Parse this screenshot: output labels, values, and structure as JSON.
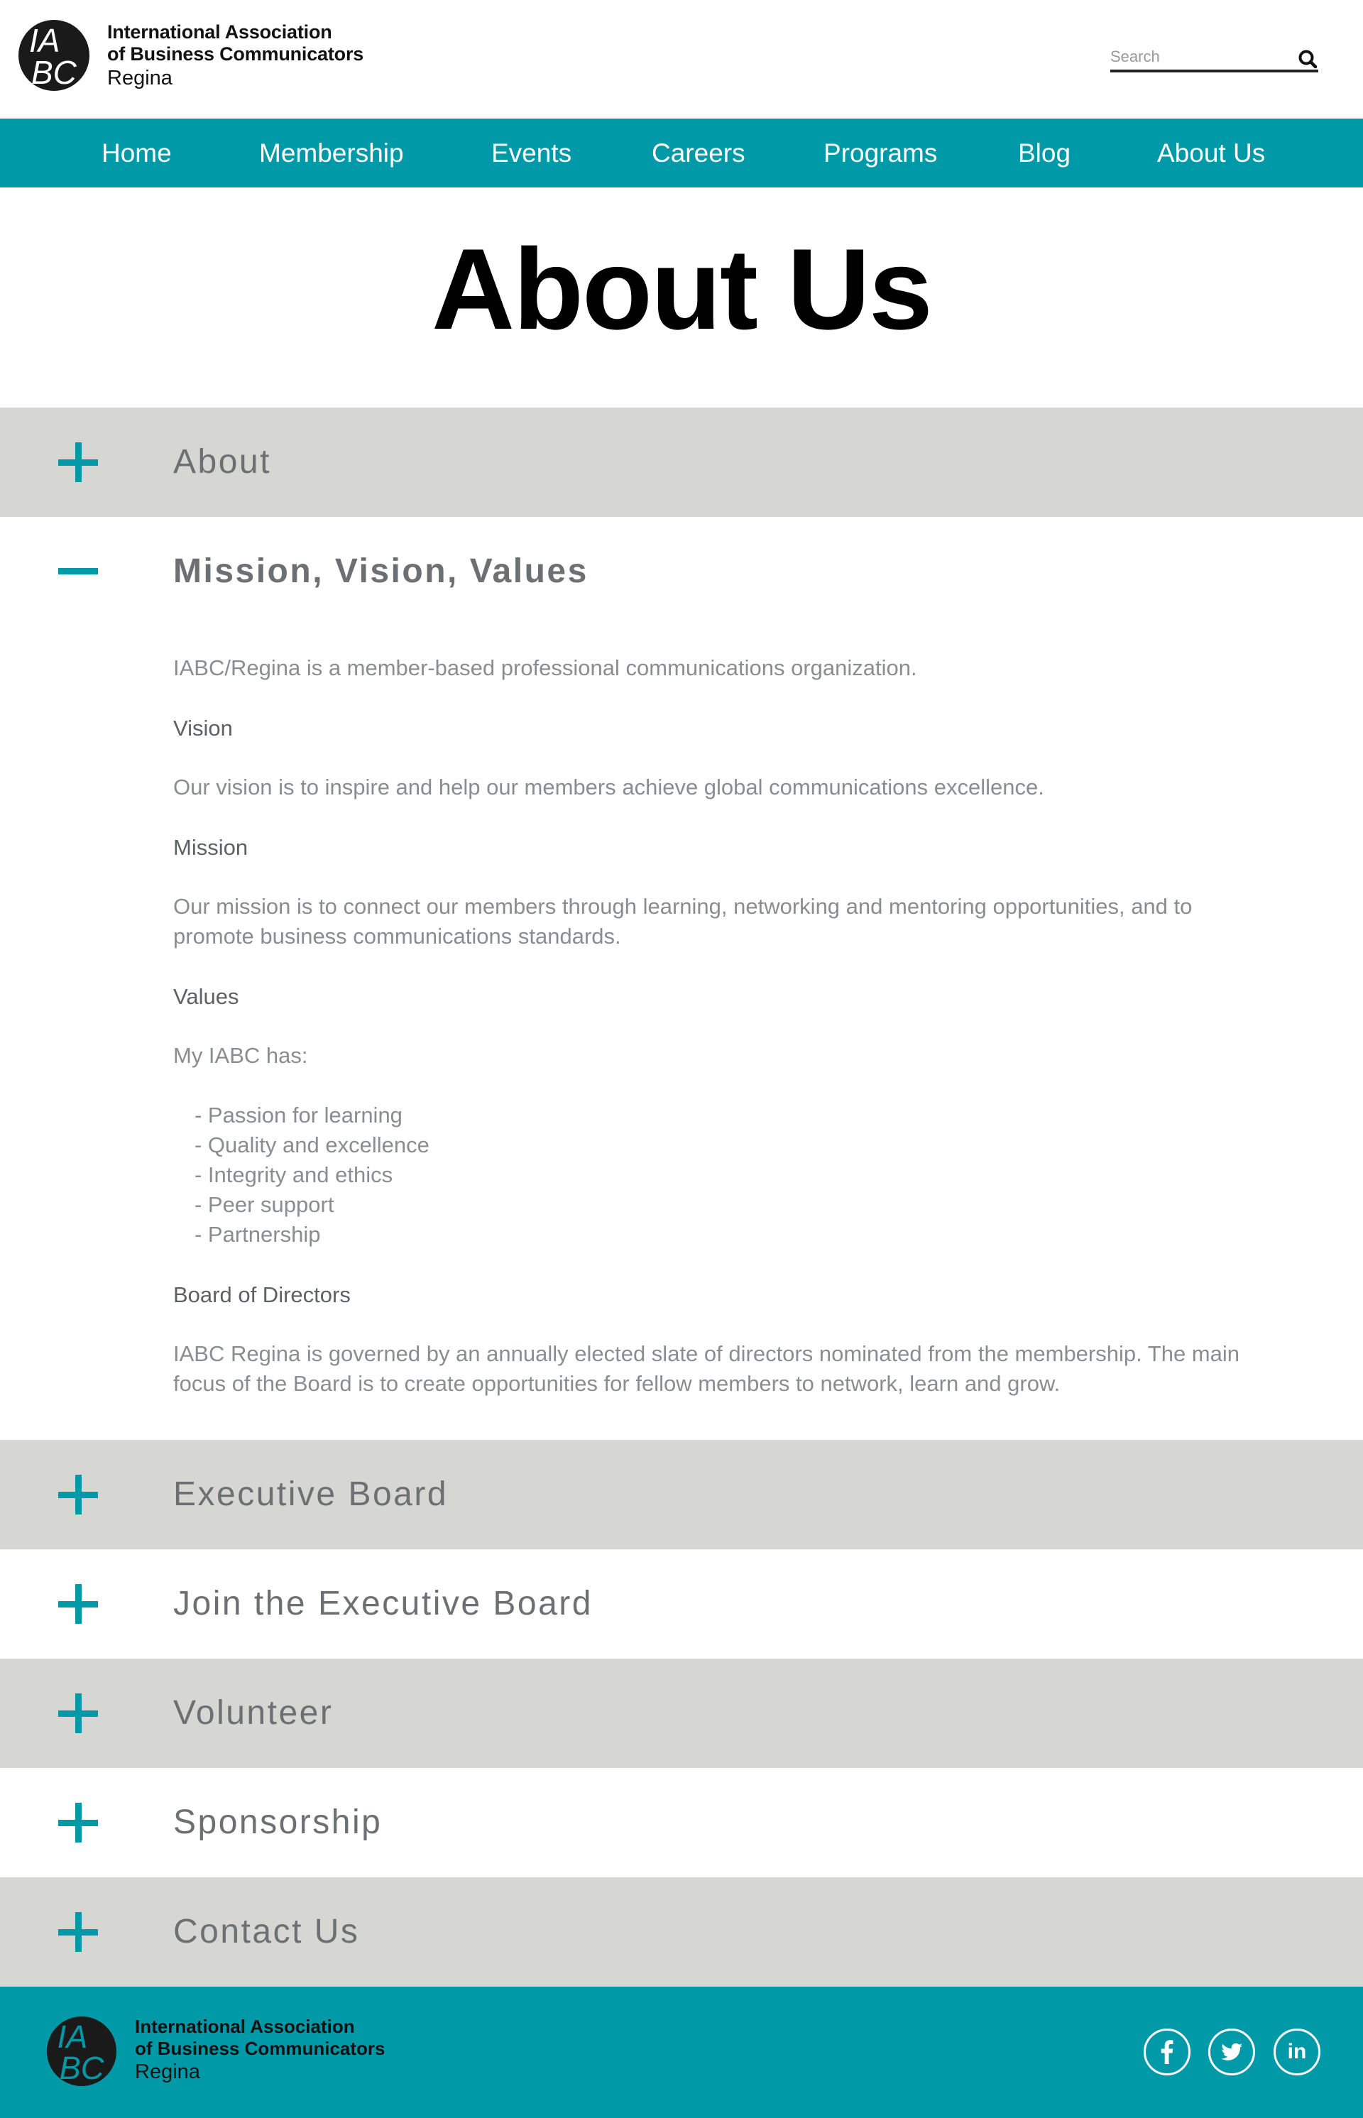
{
  "header": {
    "logo_line1": "International Association",
    "logo_line2": "of Business Communicators",
    "logo_line3": "Regina",
    "search_placeholder": "Search"
  },
  "nav": {
    "items": [
      {
        "label": "Home"
      },
      {
        "label": "Membership"
      },
      {
        "label": "Events"
      },
      {
        "label": "Careers"
      },
      {
        "label": "Programs"
      },
      {
        "label": "Blog"
      },
      {
        "label": "About Us"
      }
    ]
  },
  "page_title": "About Us",
  "accordion": {
    "sections": [
      {
        "title": "About",
        "expanded": false
      },
      {
        "title": "Mission, Vision, Values",
        "expanded": true
      },
      {
        "title": "Executive Board",
        "expanded": false
      },
      {
        "title": "Join the Executive Board",
        "expanded": false
      },
      {
        "title": "Volunteer",
        "expanded": false
      },
      {
        "title": "Sponsorship",
        "expanded": false
      },
      {
        "title": "Contact Us",
        "expanded": false
      }
    ],
    "content": {
      "intro": "IABC/Regina is a member-based professional communications organization.",
      "vision_heading": "Vision",
      "vision_text": "Our vision is to inspire and help our members achieve global communications excellence.",
      "mission_heading": "Mission",
      "mission_text_line1": "Our mission is to connect our members through learning, networking and mentoring opportunities, and to",
      "mission_text_line2": "promote business communications standards.",
      "values_heading": "Values",
      "values_intro": "My IABC has:",
      "values_list": [
        "- Passion for learning",
        "- Quality and excellence",
        "- Integrity and ethics",
        "- Peer support",
        "- Partnership"
      ],
      "board_heading": "Board of Directors",
      "board_text_line1": "IABC Regina is governed by an annually elected slate of directors nominated from the membership. The main",
      "board_text_line2": "focus of the Board is to create opportunities for fellow members to network, learn and grow."
    }
  },
  "footer": {
    "logo_line1": "International Association",
    "logo_line2": "of Business Communicators",
    "logo_line3": "Regina",
    "social": [
      {
        "name": "facebook-icon"
      },
      {
        "name": "twitter-icon"
      },
      {
        "name": "linkedin-icon",
        "label": "in"
      }
    ]
  },
  "colors": {
    "brand_teal": "#0099a8",
    "accordion_grey": "#d6d6d3",
    "heading_text": "#6d7073",
    "body_text": "#8a8d90"
  }
}
